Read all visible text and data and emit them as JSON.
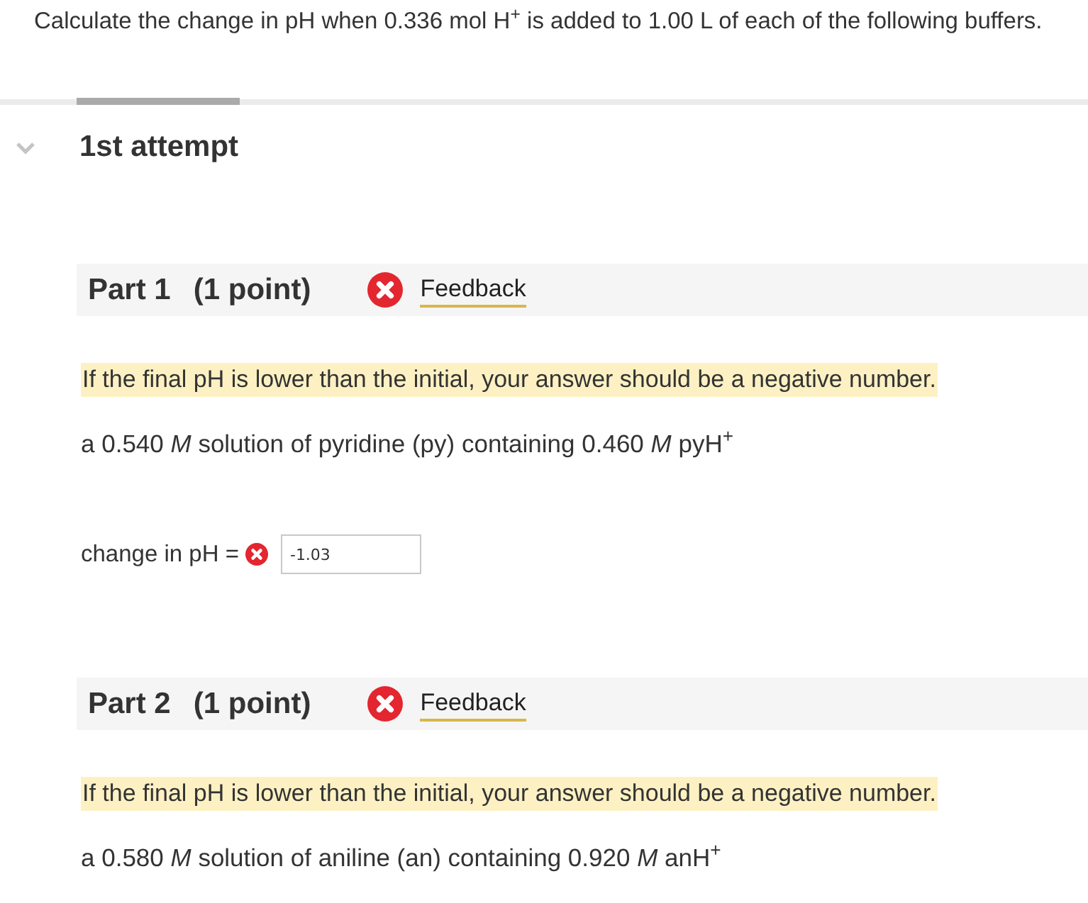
{
  "question": "Calculate the change in pH when 0.336 mol H$^{+}$ is added to 1.00 L of each of the following buffers.",
  "attempt": {
    "title": "1st attempt",
    "expanded": true
  },
  "parts": [
    {
      "title": "Part 1",
      "points": "(1 point)",
      "correct": false,
      "feedback": "Feedback",
      "hint": "If the final pH is lower than the initial, your answer should be a negative number.",
      "prompt": "a 0.540 *M* solution of pyridine (py) containing 0.460 *M* pyH$^{+}$",
      "answer": {
        "label": "change in pH =",
        "correct": false,
        "value": "-1.03"
      }
    },
    {
      "title": "Part 2",
      "points": "(1 point)",
      "correct": false,
      "feedback": "Feedback",
      "hint": "If the final pH is lower than the initial, your answer should be a negative number.",
      "prompt": "a 0.580 *M* solution of aniline (an) containing 0.920 *M* anH$^{+}$"
    }
  ]
}
